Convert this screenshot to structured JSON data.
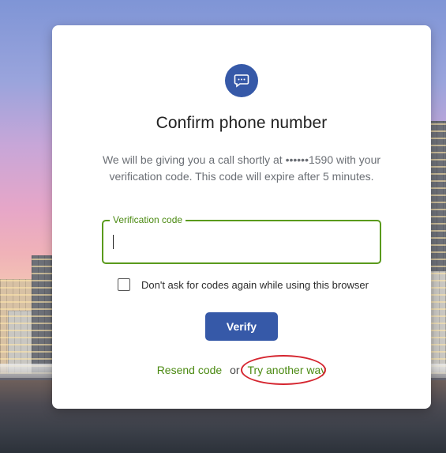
{
  "modal": {
    "title": "Confirm phone number",
    "description": "We will be giving you a call shortly at ••••••1590 with your verification code. This code will expire after 5 minutes.",
    "icon": "message-bubble-icon"
  },
  "verification": {
    "label": "Verification code",
    "value": "",
    "placeholder": ""
  },
  "remember": {
    "label": "Don't ask for codes again while using this browser",
    "checked": false
  },
  "actions": {
    "verify_label": "Verify",
    "resend_label": "Resend code",
    "or_label": "or",
    "try_another_label": "Try another way"
  },
  "colors": {
    "primary": "#3659a8",
    "link_green": "#4b8a12",
    "focus_border": "#5a9a1c",
    "highlight_red": "#d5252f"
  }
}
